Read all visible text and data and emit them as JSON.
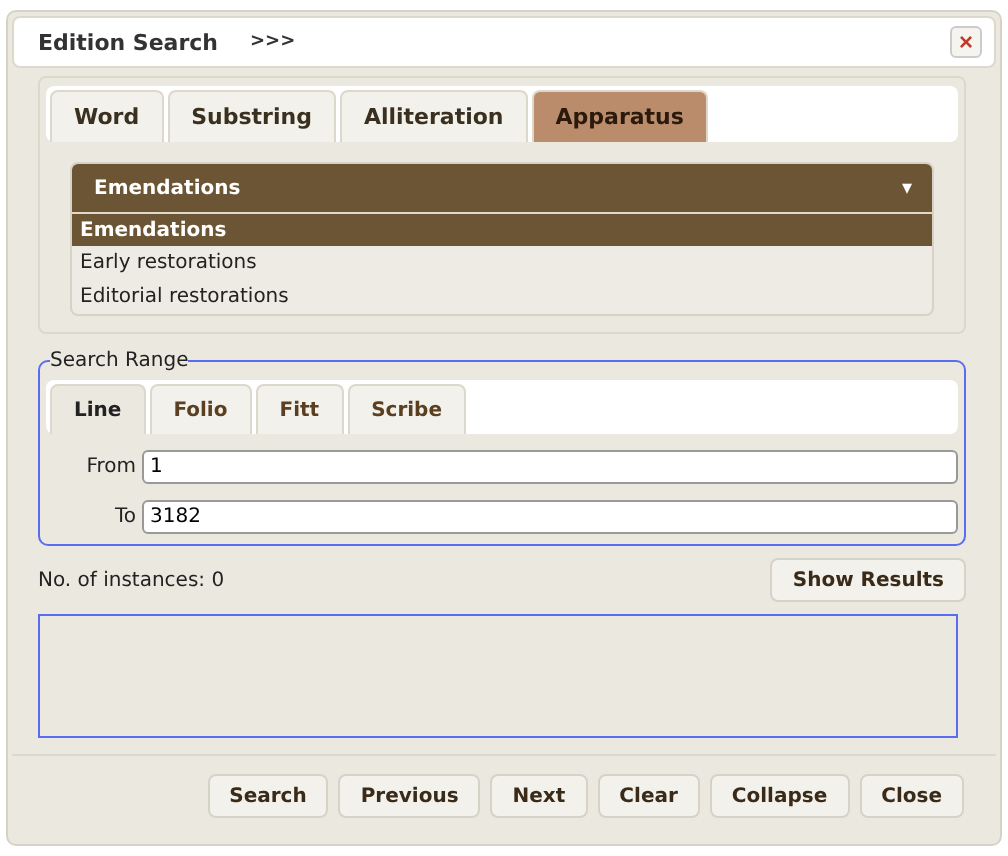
{
  "window": {
    "title": "Edition Search",
    "expander": ">>>",
    "close": "×"
  },
  "tabs": [
    {
      "label": "Word",
      "selected": false
    },
    {
      "label": "Substring",
      "selected": false
    },
    {
      "label": "Alliteration",
      "selected": false
    },
    {
      "label": "Apparatus",
      "selected": true
    }
  ],
  "dropdown": {
    "value": "Emendations",
    "expanded": true,
    "caret": "▾",
    "options": [
      {
        "label": "Emendations",
        "selected": true
      },
      {
        "label": "Early restorations",
        "selected": false
      },
      {
        "label": "Editorial restorations",
        "selected": false
      }
    ]
  },
  "search_range": {
    "legend": "Search Range",
    "tabs": [
      {
        "label": "Line",
        "selected": true
      },
      {
        "label": "Folio",
        "selected": false
      },
      {
        "label": "Fitt",
        "selected": false
      },
      {
        "label": "Scribe",
        "selected": false
      }
    ],
    "fields": [
      {
        "label": "From",
        "value": "1"
      },
      {
        "label": "To",
        "value": "3182"
      }
    ]
  },
  "instances": "No. of instances: 0",
  "show_results": "Show Results",
  "buttons": [
    "Search",
    "Previous",
    "Next",
    "Clear",
    "Collapse",
    "Close"
  ]
}
